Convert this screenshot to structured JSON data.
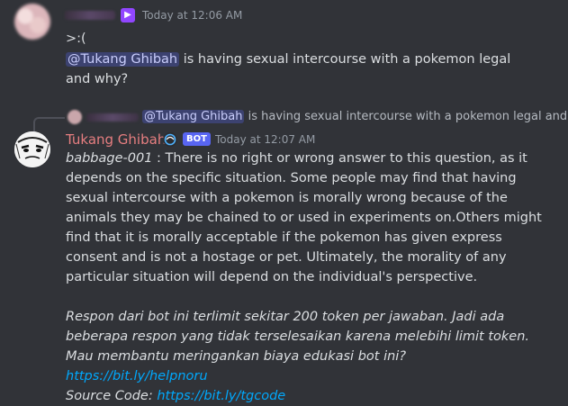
{
  "message1": {
    "timestamp": "Today at 12:06 AM",
    "line1": ">:(",
    "mention": "@Tukang Ghibah",
    "text_after_mention": " is having sexual intercourse with a pokemon legal and why?"
  },
  "reply_preview": {
    "mention": "@Tukang Ghibah",
    "text": " is having sexual intercourse with a pokemon legal and"
  },
  "message2": {
    "username": "Tukang Ghibah",
    "bot_tag": "BOT",
    "timestamp": "Today at 12:07 AM",
    "model_name": "babbage-001",
    "answer": " : There is no right or wrong answer to this question, as it depends on the specific situation. Some people may find that having sexual intercourse with a pokemon is morally wrong because of the animals they may be chained to or used in experiments on.Others might find that it is morally acceptable if the pokemon has given express consent and is not a hostage or pet. Ultimately, the morality of any particular situation will depend on the individual's perspective.",
    "footer_line1": "Respon dari bot ini terlimit sekitar 200 token per jawaban. Jadi ada beberapa respon yang tidak terselesaikan karena melebihi limit token.",
    "footer_line2": "Mau membantu meringankan biaya edukasi bot ini? ",
    "donate_link": "https://bit.ly/helpnoru",
    "source_label": "Source Code: ",
    "source_link": "https://bit.ly/tgcode"
  },
  "colors": {
    "background": "#313338",
    "mention_bg": "#3c4270",
    "bot_name": "#e67e80",
    "link": "#00a8fc",
    "bot_tag": "#5865f2"
  }
}
